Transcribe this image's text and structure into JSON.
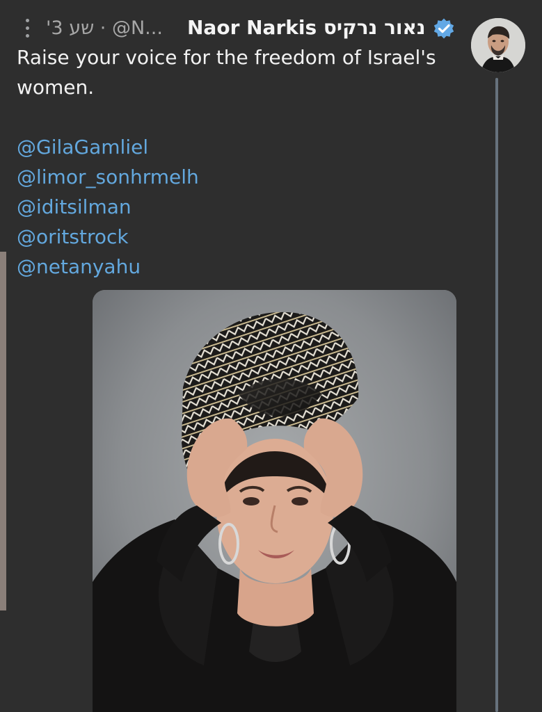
{
  "tweet": {
    "author_name": "Naor Narkis נאור נרקיס",
    "meta": "'3 שע · @N...",
    "verified_icon": "verified-badge",
    "more_icon": "more-vertical-icon",
    "text_lines": [
      "Raise your voice for the freedom of Israel's",
      "women."
    ],
    "mentions": [
      "@GilaGamliel",
      "@limor_sonhrmelh",
      "@iditsilman",
      "@oritstrock",
      "@netanyahu"
    ],
    "media": {
      "type": "photo",
      "description_icon": "photo-woman-headscarf"
    }
  },
  "colors": {
    "background": "#2e2e2e",
    "text": "#f2f2f2",
    "muted": "#a7a7a7",
    "link": "#63a8de",
    "verified": "#62a8e5",
    "thread_line": "#67727d"
  }
}
